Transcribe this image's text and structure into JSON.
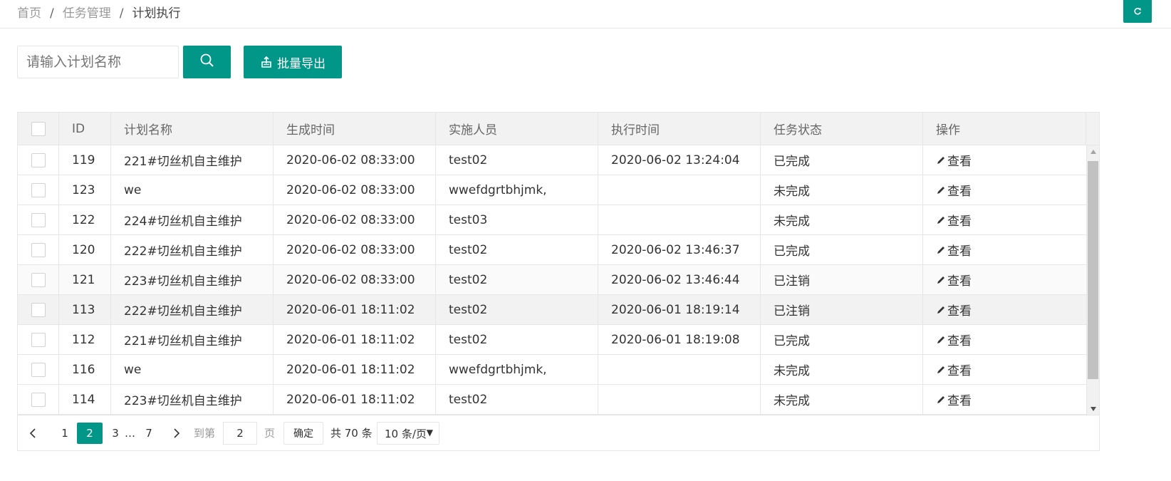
{
  "breadcrumb": {
    "items": [
      "首页",
      "任务管理",
      "计划执行"
    ],
    "separator": "/"
  },
  "refresh": {
    "icon": "refresh-icon"
  },
  "toolbar": {
    "search_placeholder": "请输入计划名称",
    "search_icon": "search-icon",
    "export_label": "批量导出",
    "export_icon": "export-icon"
  },
  "table": {
    "headers": {
      "id": "ID",
      "name": "计划名称",
      "generated": "生成时间",
      "person": "实施人员",
      "executed": "执行时间",
      "status": "任务状态",
      "operation": "操作"
    },
    "rows": [
      {
        "id": "119",
        "name": "221#切丝机自主维护",
        "generated": "2020-06-02 08:33:00",
        "person": "test02",
        "executed": "2020-06-02 13:24:04",
        "status": "已完成",
        "op": "查看"
      },
      {
        "id": "123",
        "name": "we",
        "generated": "2020-06-02 08:33:00",
        "person": "wwefdgrtbhjmk,",
        "executed": "",
        "status": "未完成",
        "op": "查看"
      },
      {
        "id": "122",
        "name": "224#切丝机自主维护",
        "generated": "2020-06-02 08:33:00",
        "person": "test03",
        "executed": "",
        "status": "未完成",
        "op": "查看"
      },
      {
        "id": "120",
        "name": "222#切丝机自主维护",
        "generated": "2020-06-02 08:33:00",
        "person": "test02",
        "executed": "2020-06-02 13:46:37",
        "status": "已完成",
        "op": "查看"
      },
      {
        "id": "121",
        "name": "223#切丝机自主维护",
        "generated": "2020-06-02 08:33:00",
        "person": "test02",
        "executed": "2020-06-02 13:46:44",
        "status": "已注销",
        "op": "查看"
      },
      {
        "id": "113",
        "name": "222#切丝机自主维护",
        "generated": "2020-06-01 18:11:02",
        "person": "test02",
        "executed": "2020-06-01 18:19:14",
        "status": "已注销",
        "op": "查看"
      },
      {
        "id": "112",
        "name": "221#切丝机自主维护",
        "generated": "2020-06-01 18:11:02",
        "person": "test02",
        "executed": "2020-06-01 18:19:08",
        "status": "已完成",
        "op": "查看"
      },
      {
        "id": "116",
        "name": "we",
        "generated": "2020-06-01 18:11:02",
        "person": "wwefdgrtbhjmk,",
        "executed": "",
        "status": "未完成",
        "op": "查看"
      },
      {
        "id": "114",
        "name": "223#切丝机自主维护",
        "generated": "2020-06-01 18:11:02",
        "person": "test02",
        "executed": "",
        "status": "未完成",
        "op": "查看"
      }
    ]
  },
  "pagination": {
    "pages": [
      "1",
      "2",
      "3",
      "…",
      "7"
    ],
    "current": "2",
    "goto_prefix": "到第",
    "goto_value": "2",
    "goto_suffix": "页",
    "confirm_label": "确定",
    "total_label": "共 70 条",
    "page_size_label": "10 条/页",
    "caret": "▼"
  },
  "colors": {
    "accent": "#009688",
    "header_bg": "#f2f2f2",
    "border": "#e6e6e6"
  }
}
